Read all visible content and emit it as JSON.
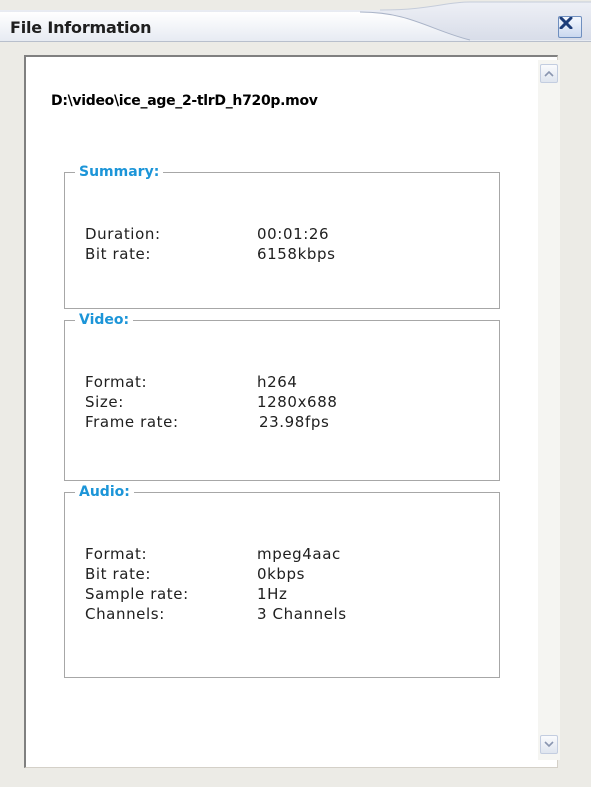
{
  "window": {
    "title": "File Information",
    "file_path": "D:\\video\\ice_age_2-tlrD_h720p.mov"
  },
  "summary": {
    "heading": "Summary:",
    "duration_label": "Duration:",
    "duration_value": "00:01:26",
    "bitrate_label": "Bit rate:",
    "bitrate_value": "6158kbps"
  },
  "video": {
    "heading": "Video:",
    "format_label": "Format:",
    "format_value": "h264",
    "size_label": "Size:",
    "size_value": "1280x688",
    "framerate_label": "Frame rate:",
    "framerate_value": "23.98fps"
  },
  "audio": {
    "heading": "Audio:",
    "format_label": "Format:",
    "format_value": "mpeg4aac",
    "bitrate_label": "Bit rate:",
    "bitrate_value": "0kbps",
    "samplerate_label": "Sample rate:",
    "samplerate_value": "1Hz",
    "channels_label": "Channels:",
    "channels_value": "3 Channels"
  },
  "icons": {
    "close": "close-icon",
    "scroll_up": "chevron-up-icon",
    "scroll_down": "chevron-down-icon"
  },
  "colors": {
    "section_heading": "#1c95d8",
    "title_text": "#1f1f1f"
  }
}
